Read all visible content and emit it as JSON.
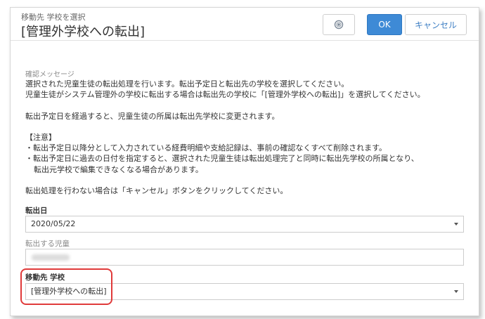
{
  "header": {
    "subtitle": "移動先 学校を選択",
    "title": "[管理外学校への転出]",
    "help_icon": "help-circle-icon",
    "ok_label": "OK",
    "cancel_label": "キャンセル"
  },
  "message": {
    "label": "確認メッセージ",
    "lines": [
      "選択された児童生徒の転出処理を行います。転出予定日と転出先の学校を選択してください。",
      "児童生徒がシステム管理外の学校に転出する場合は転出先の学校に「[管理外学校への転出]」を選択してください。",
      "",
      "転出予定日を経過すると、児童生徒の所属は転出先学校に変更されます。",
      "",
      "【注意】",
      "・転出予定日以降分として入力されている経費明細や支給記録は、事前の確認なくすべて削除されます。",
      "・転出予定日に過去の日付を指定すると、選択された児童生徒は転出処理完了と同時に転出先学校の所属となり、",
      "転出元学校で編集できなくなる場合があります。",
      "",
      "転出処理を行わない場合は「キャンセル」ボタンをクリックしてください。"
    ]
  },
  "fields": {
    "transfer_date": {
      "label": "転出日",
      "value": "2020/05/22"
    },
    "student": {
      "label": "転出する児童",
      "value": ""
    },
    "destination_school": {
      "label": "移動先 学校",
      "value": "[管理外学校への転出]"
    }
  },
  "colors": {
    "primary_button": "#3e8ad6",
    "highlight_border": "#e03a3a"
  }
}
